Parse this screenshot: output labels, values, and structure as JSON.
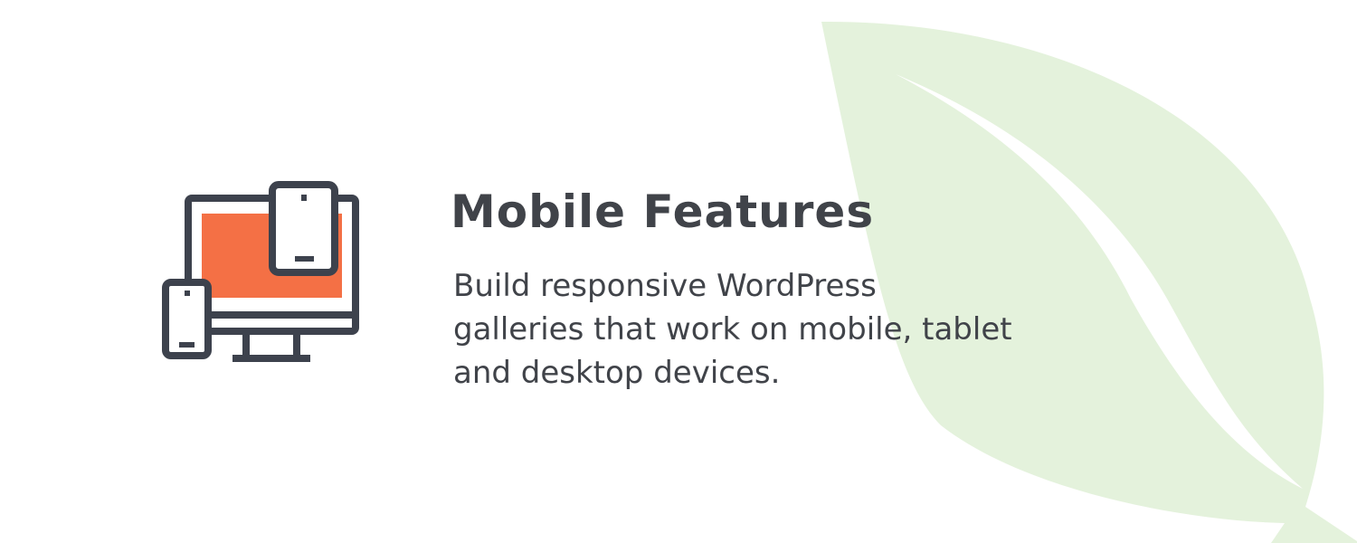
{
  "feature": {
    "title": "Mobile Features",
    "description": "Build responsive WordPress galleries that work on mobile, tablet and desktop devices.",
    "icon": "devices-icon"
  },
  "background": {
    "decoration": "leaf-icon"
  },
  "colors": {
    "text": "#404349",
    "icon_stroke": "#3d424d",
    "icon_accent": "#f47045",
    "leaf": "#e4f2dc",
    "background": "#ffffff"
  }
}
